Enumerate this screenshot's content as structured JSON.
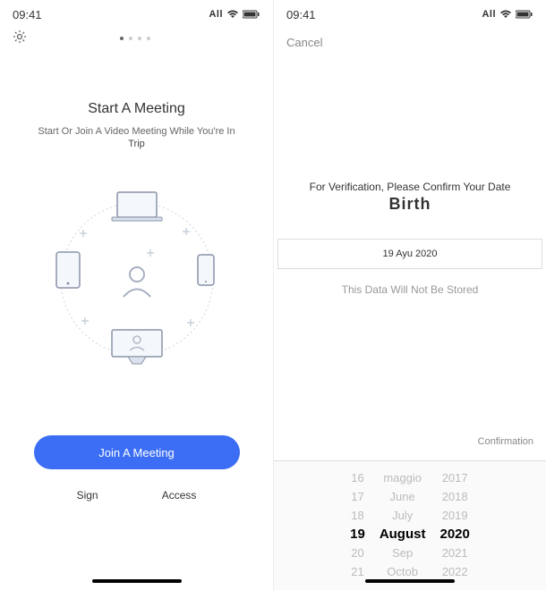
{
  "status": {
    "time": "09:41",
    "carrier": "All"
  },
  "left": {
    "title": "Start A Meeting",
    "subtitle": "Start Or Join A Video Meeting While You're In",
    "subtitle2": "Trip",
    "join_btn": "Join A Meeting",
    "sign": "Sign",
    "access": "Access"
  },
  "right": {
    "cancel": "Cancel",
    "verify": "For Verification, Please Confirm Your Date",
    "birth": "Birth",
    "date_display": "19 Ayu 2020",
    "note": "This Data Will Not Be Stored",
    "confirm": "Confirmation",
    "picker": {
      "days": [
        "16",
        "17",
        "18",
        "19",
        "20",
        "21"
      ],
      "months": [
        "maggio",
        "June",
        "July",
        "August",
        "Sep",
        "Octob"
      ],
      "years": [
        "2017",
        "2018",
        "2019",
        "2020",
        "2021",
        "2022"
      ],
      "selected_day": "19",
      "selected_month": "August",
      "selected_year": "2020"
    }
  }
}
